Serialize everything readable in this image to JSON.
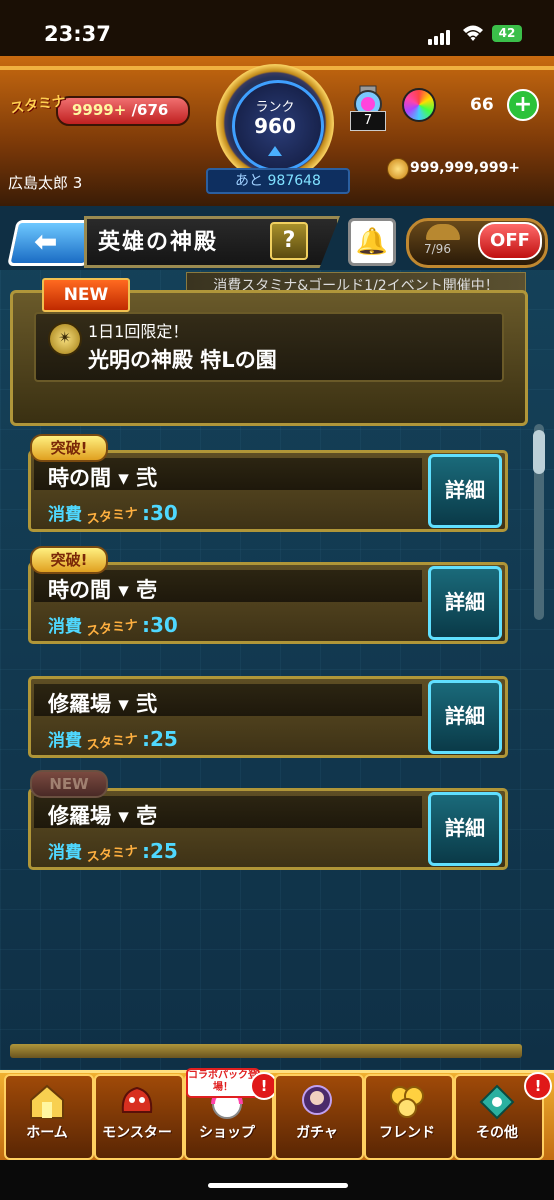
{
  "status": {
    "time": "23:37",
    "battery": "42"
  },
  "top": {
    "stamina_label": "スタミナ",
    "stamina_value": "9999+",
    "stamina_max": "/676",
    "rank_label": "ランク",
    "rank_value": "960",
    "ato_label": "あと",
    "ato_value": "987648",
    "potion_count": "7",
    "orb_count": "66",
    "plus_label": "+",
    "user_name": "広島太郎 3",
    "gold": "999,999,999+"
  },
  "header": {
    "title": "英雄の神殿",
    "help": "?",
    "toggle_count": "7/96",
    "off_label": "OFF"
  },
  "event_text": "消費スタミナ&ゴールド1/2イベント開催中！",
  "special": {
    "new_label": "NEW",
    "subtitle": "1日1回限定！",
    "title": "光明の神殿 特Lの園"
  },
  "quests": [
    {
      "tag": "突破!",
      "name": "時の間 ▾ 弐",
      "cost_label": "消費",
      "stamina_label": "スタミナ",
      "cost": ":30",
      "detail": "詳細"
    },
    {
      "tag": "突破!",
      "name": "時の間 ▾ 壱",
      "cost_label": "消費",
      "stamina_label": "スタミナ",
      "cost": ":30",
      "detail": "詳細"
    },
    {
      "tag": "",
      "name": "修羅場 ▾ 弐",
      "cost_label": "消費",
      "stamina_label": "スタミナ",
      "cost": ":25",
      "detail": "詳細"
    },
    {
      "tag": "NEW",
      "name": "修羅場 ▾ 壱",
      "cost_label": "消費",
      "stamina_label": "スタミナ",
      "cost": ":25",
      "detail": "詳細"
    }
  ],
  "tabs": [
    {
      "label": "ホーム",
      "icon": "home-icon"
    },
    {
      "label": "モンスター",
      "icon": "monster-icon"
    },
    {
      "label": "ショップ",
      "icon": "shop-icon"
    },
    {
      "label": "ガチャ",
      "icon": "gacha-icon"
    },
    {
      "label": "フレンド",
      "icon": "friend-icon"
    },
    {
      "label": "その他",
      "icon": "other-icon"
    }
  ],
  "collab_badge": "コラボパック登場！",
  "excl": "!"
}
